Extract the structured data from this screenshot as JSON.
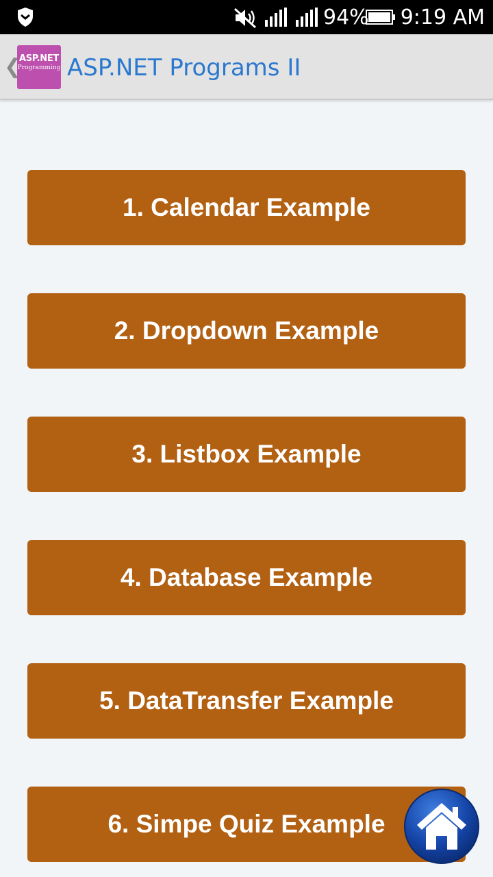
{
  "status_bar": {
    "battery_percent": "94%",
    "time": "9:19 AM",
    "icons": [
      "shield-icon",
      "mute-icon",
      "signal-icon",
      "signal-icon",
      "battery-icon"
    ]
  },
  "action_bar": {
    "back_glyph": "❮",
    "logo_line1": "ASP.NET",
    "logo_line2": "Programming",
    "title": "ASP.NET Programs II",
    "title_color": "#2b78cf"
  },
  "menu": {
    "button_color": "#b26012",
    "items": [
      {
        "label": "1. Calendar Example"
      },
      {
        "label": "2. Dropdown Example"
      },
      {
        "label": "3. Listbox Example"
      },
      {
        "label": "4. Database Example"
      },
      {
        "label": "5. DataTransfer Example"
      },
      {
        "label": "6. Simpe Quiz Example"
      }
    ]
  },
  "fab": {
    "icon": "home-icon"
  }
}
